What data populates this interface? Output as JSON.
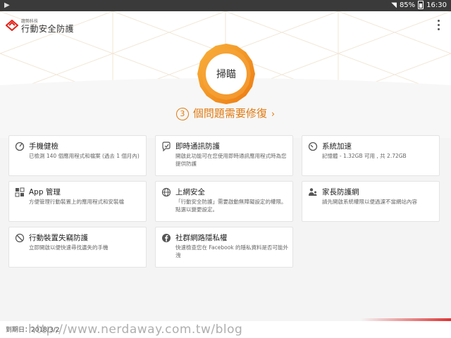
{
  "status": {
    "battery_percent": "85%",
    "time": "16:30",
    "left_icon": "play-store-icon"
  },
  "app": {
    "brand_small": "趨勢科技",
    "title": "行動安全防護",
    "menu_icon": "more-vert-icon",
    "accent": "#f39a1e",
    "brand_red": "#e2231a"
  },
  "scan": {
    "label": "掃瞄"
  },
  "issues": {
    "count": "3",
    "text": "個問題需要修復",
    "arrow": "›"
  },
  "features": [
    {
      "icon": "phone-checkup-icon",
      "title": "手機健檢",
      "desc": "已檢測 140 個應用程式和檔案 (過去 1 個月內)"
    },
    {
      "icon": "im-protection-icon",
      "title": "即時通訊防護",
      "desc": "開啟此功能可在您使用即時通訊應用程式時為您提供防護"
    },
    {
      "icon": "speedometer-icon",
      "title": "系統加速",
      "desc": "記憶體 - 1.32GB 可用 , 共 2.72GB"
    },
    {
      "icon": "app-grid-icon",
      "title": "App 管理",
      "desc": "方便管理行動裝置上的應用程式和安裝檔"
    },
    {
      "icon": "globe-icon",
      "title": "上網安全",
      "desc": "「行動安全防護」需要啟動無障礙設定的權限。點選以變更設定。"
    },
    {
      "icon": "parental-icon",
      "title": "家長防護網",
      "desc": "請先開啟系統權限以便過濾不當網站內容"
    },
    {
      "icon": "lost-device-icon",
      "title": "行動裝置失竊防護",
      "desc": "立即開啟以便快速尋找遺失的手機"
    },
    {
      "icon": "facebook-icon",
      "title": "社群網路隱私權",
      "desc": "快速檢查您在 Facebook 的隱私資料是否可能外洩"
    }
  ],
  "footer": {
    "expiry": "到期日：2018/3/2",
    "watermark": "http://www.nerdaway.com.tw/blog"
  }
}
